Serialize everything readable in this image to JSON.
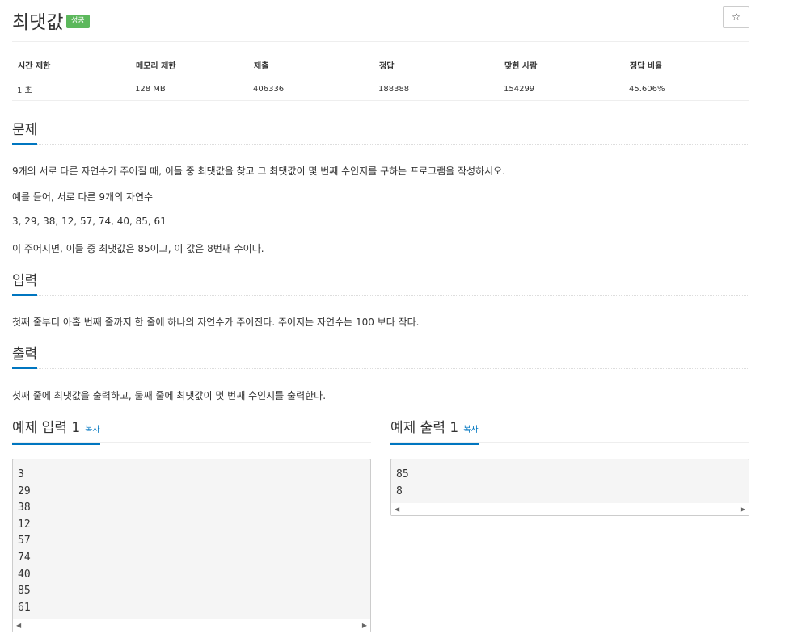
{
  "problem": {
    "title": "최댓값",
    "status_badge": "성공",
    "star_icon": "☆"
  },
  "info_table": {
    "headers": [
      "시간 제한",
      "메모리 제한",
      "제출",
      "정답",
      "맞힌 사람",
      "정답 비율"
    ],
    "values": [
      "1 초",
      "128 MB",
      "406336",
      "188388",
      "154299",
      "45.606%"
    ]
  },
  "sections": {
    "description": {
      "heading": "문제",
      "paragraphs": [
        "9개의 서로 다른 자연수가 주어질 때, 이들 중 최댓값을 찾고 그 최댓값이 몇 번째 수인지를 구하는 프로그램을 작성하시오.",
        "예를 들어, 서로 다른 9개의 자연수",
        "3, 29, 38, 12, 57, 74, 40, 85, 61",
        "이 주어지면, 이들 중 최댓값은 85이고, 이 값은 8번째 수이다."
      ]
    },
    "input": {
      "heading": "입력",
      "text": "첫째 줄부터 아홉 번째 줄까지 한 줄에 하나의 자연수가 주어진다. 주어지는 자연수는 100 보다 작다."
    },
    "output": {
      "heading": "출력",
      "text": "첫째 줄에 최댓값을 출력하고, 둘째 줄에 최댓값이 몇 번째 수인지를 출력한다."
    }
  },
  "samples": {
    "input": {
      "heading": "예제 입력 1",
      "copy_label": "복사",
      "content": "3\n29\n38\n12\n57\n74\n40\n85\n61"
    },
    "output": {
      "heading": "예제 출력 1",
      "copy_label": "복사",
      "content": "85\n8"
    }
  },
  "colors": {
    "accent": "#0076c0",
    "success": "#5cb85c"
  }
}
